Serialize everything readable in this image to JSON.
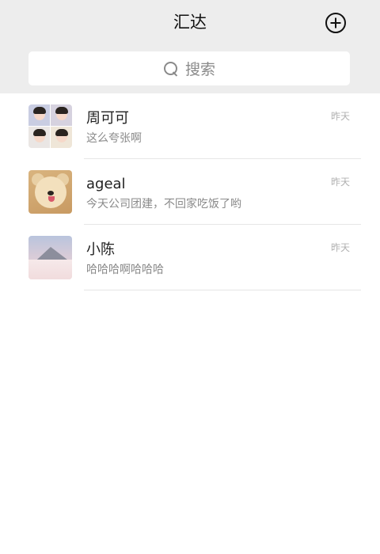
{
  "header": {
    "title": "汇达",
    "add_icon": "plus-circle-icon"
  },
  "search": {
    "icon": "search-icon",
    "label": "搜索"
  },
  "chats": [
    {
      "name": "周可可",
      "preview": "这么夸张啊",
      "time": "昨天",
      "avatar": "baby-photo-collage"
    },
    {
      "name": "ageal",
      "preview": "今天公司团建，不回家吃饭了哟",
      "time": "昨天",
      "avatar": "puppy-photo"
    },
    {
      "name": "小陈",
      "preview": "哈哈哈啊哈哈哈",
      "time": "昨天",
      "avatar": "snow-mountain-photo"
    }
  ]
}
